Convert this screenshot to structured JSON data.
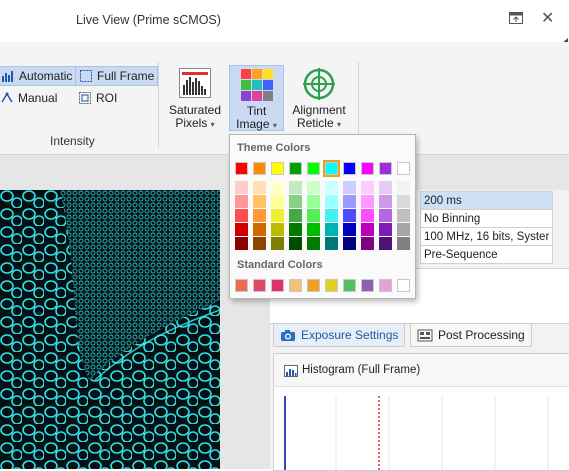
{
  "window": {
    "title": "Live View (Prime sCMOS)"
  },
  "ribbon": {
    "automatic_label": "Automatic",
    "manual_label": "Manual",
    "full_frame_label": "Full Frame",
    "roi_label": "ROI",
    "intensity_group_label": "Intensity",
    "saturated_pixels_line1": "Saturated",
    "saturated_pixels_line2": "Pixels",
    "tint_image_line1": "Tint",
    "tint_image_line2": "Image",
    "alignment_reticle_line1": "Alignment",
    "alignment_reticle_line2": "Reticle",
    "caret": "▾"
  },
  "color_popup": {
    "theme_header": "Theme Colors",
    "standard_header": "Standard Colors",
    "theme_colors": [
      "#ff0000",
      "#ff8c00",
      "#ffff00",
      "#00a000",
      "#00ff00",
      "#00ffff",
      "#0000ff",
      "#ff00ff",
      "#9b30d9",
      "#ffffff"
    ],
    "selected_theme_index": 5,
    "theme_shades": [
      [
        "#ffcccc",
        "#ff9999",
        "#ff4d4d",
        "#cc0000",
        "#8b0000"
      ],
      [
        "#ffe0b3",
        "#ffc266",
        "#ff9933",
        "#cc6a00",
        "#8b4500"
      ],
      [
        "#ffffcc",
        "#ffff99",
        "#eeee33",
        "#bbbb00",
        "#808000"
      ],
      [
        "#c4e8c4",
        "#88d088",
        "#44aa44",
        "#007a00",
        "#004d00"
      ],
      [
        "#ccffcc",
        "#99ff99",
        "#55ee55",
        "#00bb00",
        "#007a00"
      ],
      [
        "#ccffff",
        "#99ffff",
        "#44f0f0",
        "#00b3b3",
        "#007878"
      ],
      [
        "#ccccff",
        "#9999ff",
        "#4d4dff",
        "#0000bb",
        "#000080"
      ],
      [
        "#ffccff",
        "#ff99ff",
        "#ff4dff",
        "#bb00bb",
        "#800080"
      ],
      [
        "#e6ccf5",
        "#cd99eb",
        "#b366e0",
        "#7a1fb0",
        "#4f1473"
      ],
      [
        "#f2f2f2",
        "#d9d9d9",
        "#bfbfbf",
        "#a6a6a6",
        "#808080"
      ]
    ],
    "standard_colors": [
      "#f06a50",
      "#e04868",
      "#dd3366",
      "#f5c07a",
      "#f0a020",
      "#e0d020",
      "#50c060",
      "#9060b0",
      "#e5a0d8",
      "#ffffff"
    ]
  },
  "properties": {
    "rows": [
      {
        "value": "200 ms",
        "selected": true
      },
      {
        "value": "No Binning",
        "selected": false
      },
      {
        "value": "100 MHz, 16 bits, Syster",
        "selected": false
      },
      {
        "value": "Pre-Sequence",
        "selected": false
      }
    ]
  },
  "tabs": {
    "exposure_settings": "Exposure Settings",
    "post_processing": "Post Processing"
  },
  "histogram": {
    "title": "Histogram (Full Frame)"
  },
  "colors": {
    "accent": "#1e5aa8",
    "ribbon_selected": "#c9daf2",
    "histogram_marker": "#e03030"
  }
}
